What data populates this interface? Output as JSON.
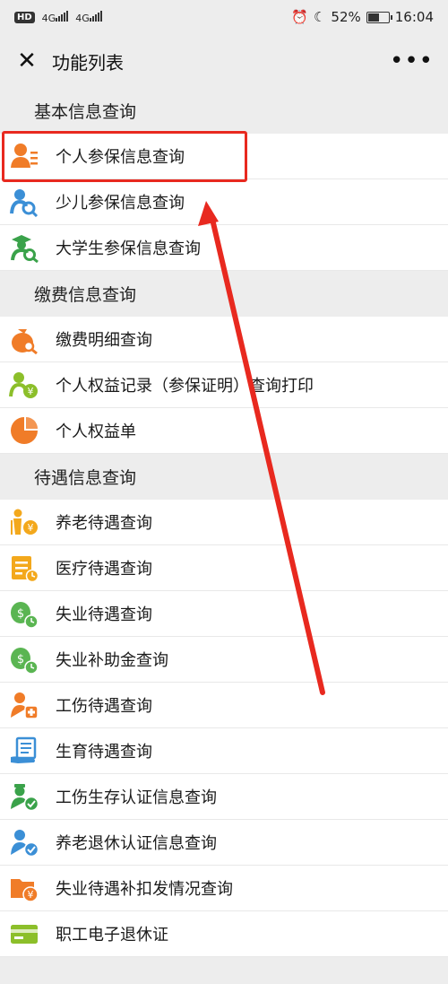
{
  "status_bar": {
    "left_badges": [
      "HD",
      "4G",
      "4G"
    ],
    "battery_percent": "52%",
    "time": "16:04"
  },
  "nav": {
    "title": "功能列表"
  },
  "sections": [
    {
      "title": "基本信息查询",
      "items": [
        {
          "label": "个人参保信息查询",
          "icon": "person-list-icon"
        },
        {
          "label": "少儿参保信息查询",
          "icon": "child-search-icon"
        },
        {
          "label": "大学生参保信息查询",
          "icon": "graduate-search-icon"
        }
      ]
    },
    {
      "title": "缴费信息查询",
      "items": [
        {
          "label": "缴费明细查询",
          "icon": "money-bag-search-icon"
        },
        {
          "label": "个人权益记录（参保证明）查询打印",
          "icon": "person-yuan-icon"
        },
        {
          "label": "个人权益单",
          "icon": "pie-chart-icon"
        }
      ]
    },
    {
      "title": "待遇信息查询",
      "items": [
        {
          "label": "养老待遇查询",
          "icon": "elderly-yuan-icon"
        },
        {
          "label": "医疗待遇查询",
          "icon": "medical-notepad-icon"
        },
        {
          "label": "失业待遇查询",
          "icon": "coins-clock-icon"
        },
        {
          "label": "失业补助金查询",
          "icon": "coins-clock-green-icon"
        },
        {
          "label": "工伤待遇查询",
          "icon": "worker-injury-icon"
        },
        {
          "label": "生育待遇查询",
          "icon": "document-hand-icon"
        },
        {
          "label": "工伤生存认证信息查询",
          "icon": "worker-check-icon"
        },
        {
          "label": "养老退休认证信息查询",
          "icon": "retiree-check-icon"
        },
        {
          "label": "失业待遇补扣发情况查询",
          "icon": "folder-yuan-icon"
        },
        {
          "label": "职工电子退休证",
          "icon": "card-icon"
        }
      ]
    }
  ],
  "colors": {
    "highlight": "#e8291f",
    "orange": "#f07c28",
    "blue": "#3b8fd6",
    "green": "#3aa24a",
    "yellow": "#f3a81c"
  }
}
